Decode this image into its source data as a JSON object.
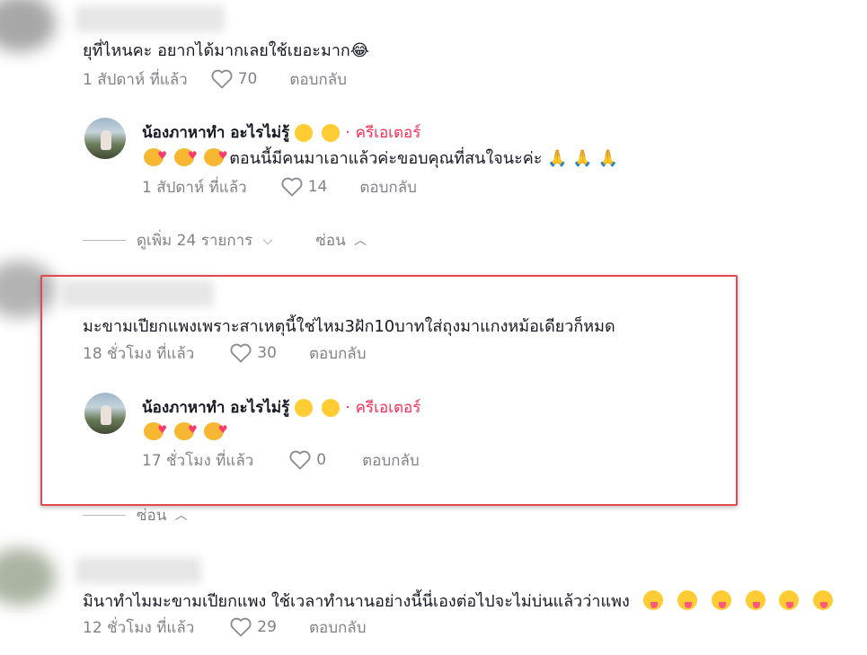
{
  "comments": [
    {
      "text": "ยุที่ไหนคะ อยากได้มากเลยใช้เยอะมาก😂",
      "time": "1 สัปดาห์ ที่แล้ว",
      "likes": "70",
      "reply_label": "ตอบกลับ"
    },
    {
      "text": "มะขามเปียกแพงเพราะสาเหตุนี้ใช่ไหม3ฝัก10บาทใส่ถุงมาแกงหม้อเดียวก็หมด",
      "time": "18 ชั่วโมง ที่แล้ว",
      "likes": "30",
      "reply_label": "ตอบกลับ"
    },
    {
      "text": "มินาทำไมมะขามเปียกแพง ใช้เวลาทำนานอย่างนี้นี่เองต่อไปจะไม่บ่นแล้วว่าแพง",
      "time": "12 ชั่วโมง ที่แล้ว",
      "likes": "29",
      "reply_label": "ตอบกลับ"
    }
  ],
  "replies": [
    {
      "author": "น้องภาหาทำ อะไรไม่รู้",
      "separator": "·",
      "badge": "ครีเอเตอร์",
      "text": "ตอนนี้มีคนมาเอาแล้วค่ะขอบคุณที่สนใจนะค่ะ",
      "time": "1 สัปดาห์ ที่แล้ว",
      "likes": "14",
      "reply_label": "ตอบกลับ"
    },
    {
      "author": "น้องภาหาทำ อะไรไม่รู้",
      "separator": "·",
      "badge": "ครีเอเตอร์",
      "text": "",
      "time": "17 ชั่วโมง ที่แล้ว",
      "likes": "0",
      "reply_label": "ตอบกลับ"
    }
  ],
  "thread_controls": {
    "view_more": "ดูเพิ่ม 24 รายการ",
    "hide_1": "ซ่อน",
    "hide_2": "ซ่อน"
  },
  "colors": {
    "creator_badge": "#fe2c55",
    "highlight_border": "#e5484d",
    "meta_text": "#8a8b91"
  },
  "icons": {
    "like": "heart-outline-icon",
    "expand": "chevron-down-icon",
    "collapse": "chevron-up-icon"
  }
}
